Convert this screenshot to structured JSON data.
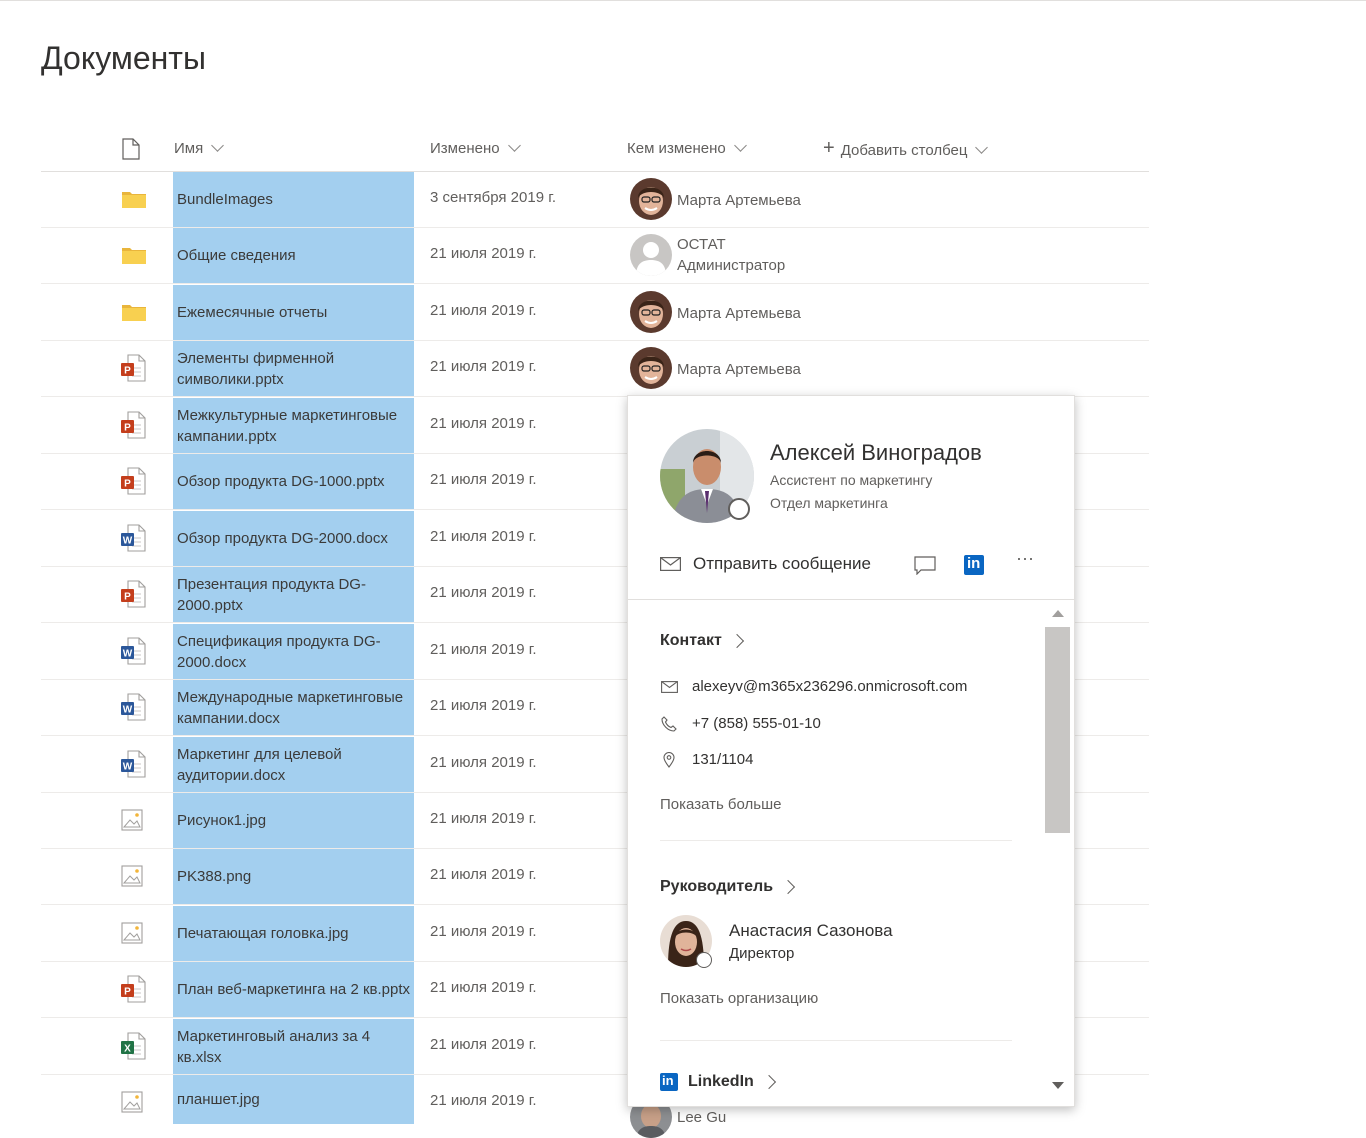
{
  "page": {
    "title": "Документы"
  },
  "columns": {
    "type_icon": "document-icon",
    "name": "Имя",
    "modified": "Изменено",
    "modified_by": "Кем изменено",
    "add_column": "Добавить столбец"
  },
  "files": [
    {
      "icon": "folder",
      "name": "BundleImages",
      "date": "3 сентября 2019 г.",
      "user": "Марта Артемьева",
      "user2": "",
      "avatar": "woman"
    },
    {
      "icon": "folder",
      "name": "Общие сведения",
      "date": "21 июля 2019 г.",
      "user": "ОСТАТ",
      "user2": "Администратор",
      "avatar": "placeholder"
    },
    {
      "icon": "folder",
      "name": "Ежемесячные отчеты",
      "date": "21 июля 2019 г.",
      "user": "Марта Артемьева",
      "user2": "",
      "avatar": "woman"
    },
    {
      "icon": "pptx",
      "name": "Элементы фирменной символики.pptx",
      "date": "21 июля 2019 г.",
      "user": "Марта Артемьева",
      "user2": "",
      "avatar": "woman"
    },
    {
      "icon": "pptx",
      "name": "Межкультурные маркетинговые кампании.pptx",
      "date": "21 июля 2019 г.",
      "user": "",
      "user2": "",
      "avatar": ""
    },
    {
      "icon": "pptx",
      "name": "Обзор продукта DG-1000.pptx",
      "date": "21 июля 2019 г.",
      "user": "",
      "user2": "",
      "avatar": ""
    },
    {
      "icon": "docx",
      "name": "Обзор продукта DG-2000.docx",
      "date": "21 июля 2019 г.",
      "user": "",
      "user2": "",
      "avatar": ""
    },
    {
      "icon": "pptx",
      "name": "Презентация продукта DG-2000.pptx",
      "date": "21 июля 2019 г.",
      "user": "",
      "user2": "",
      "avatar": ""
    },
    {
      "icon": "docx",
      "name": "Спецификация продукта DG-2000.docx",
      "date": "21 июля 2019 г.",
      "user": "",
      "user2": "",
      "avatar": ""
    },
    {
      "icon": "docx",
      "name": "Международные маркетинговые кампании.docx",
      "date": "21 июля 2019 г.",
      "user": "",
      "user2": "",
      "avatar": ""
    },
    {
      "icon": "docx",
      "name": "Маркетинг для целевой аудитории.docx",
      "date": "21 июля 2019 г.",
      "user": "",
      "user2": "",
      "avatar": ""
    },
    {
      "icon": "image",
      "name": "Рисунок1.jpg",
      "date": "21 июля 2019 г.",
      "user": "",
      "user2": "",
      "avatar": ""
    },
    {
      "icon": "image",
      "name": "PK388.png",
      "date": "21 июля 2019 г.",
      "user": "",
      "user2": "",
      "avatar": ""
    },
    {
      "icon": "image",
      "name": "Печатающая головка.jpg",
      "date": "21 июля 2019 г.",
      "user": "",
      "user2": "",
      "avatar": ""
    },
    {
      "icon": "pptx",
      "name": "План веб-маркетинга на 2 кв.pptx",
      "date": "21 июля 2019 г.",
      "user": "",
      "user2": "",
      "avatar": ""
    },
    {
      "icon": "xlsx",
      "name": "Маркетинговый анализ за 4 кв.xlsx",
      "date": "21 июля 2019 г.",
      "user": "",
      "user2": "",
      "avatar": ""
    },
    {
      "icon": "image",
      "name": "планшет.jpg",
      "date": "21 июля 2019 г.",
      "user": "Lee Gu",
      "user2": "",
      "avatar": "man"
    }
  ],
  "card": {
    "name": "Алексей Виноградов",
    "job": "Ассистент по маркетингу",
    "department": "Отдел маркетинга",
    "send_message": "Отправить сообщение",
    "contact": {
      "title": "Контакт",
      "email": "alexeyv@m365x236296.onmicrosoft.com",
      "phone": "+7 (858) 555-01-10",
      "office": "131/1104",
      "show_more": "Показать больше"
    },
    "manager": {
      "title": "Руководитель",
      "name": "Анастасия Сазонова",
      "job": "Директор",
      "show_org": "Показать организацию"
    },
    "linkedin": {
      "title": "LinkedIn"
    }
  },
  "colors": {
    "selection": "#a3cfef",
    "folder": "#f8d050",
    "powerpoint": "#c43e1c",
    "word": "#2b579a",
    "excel": "#217346",
    "linkedin": "#0a66c2"
  }
}
